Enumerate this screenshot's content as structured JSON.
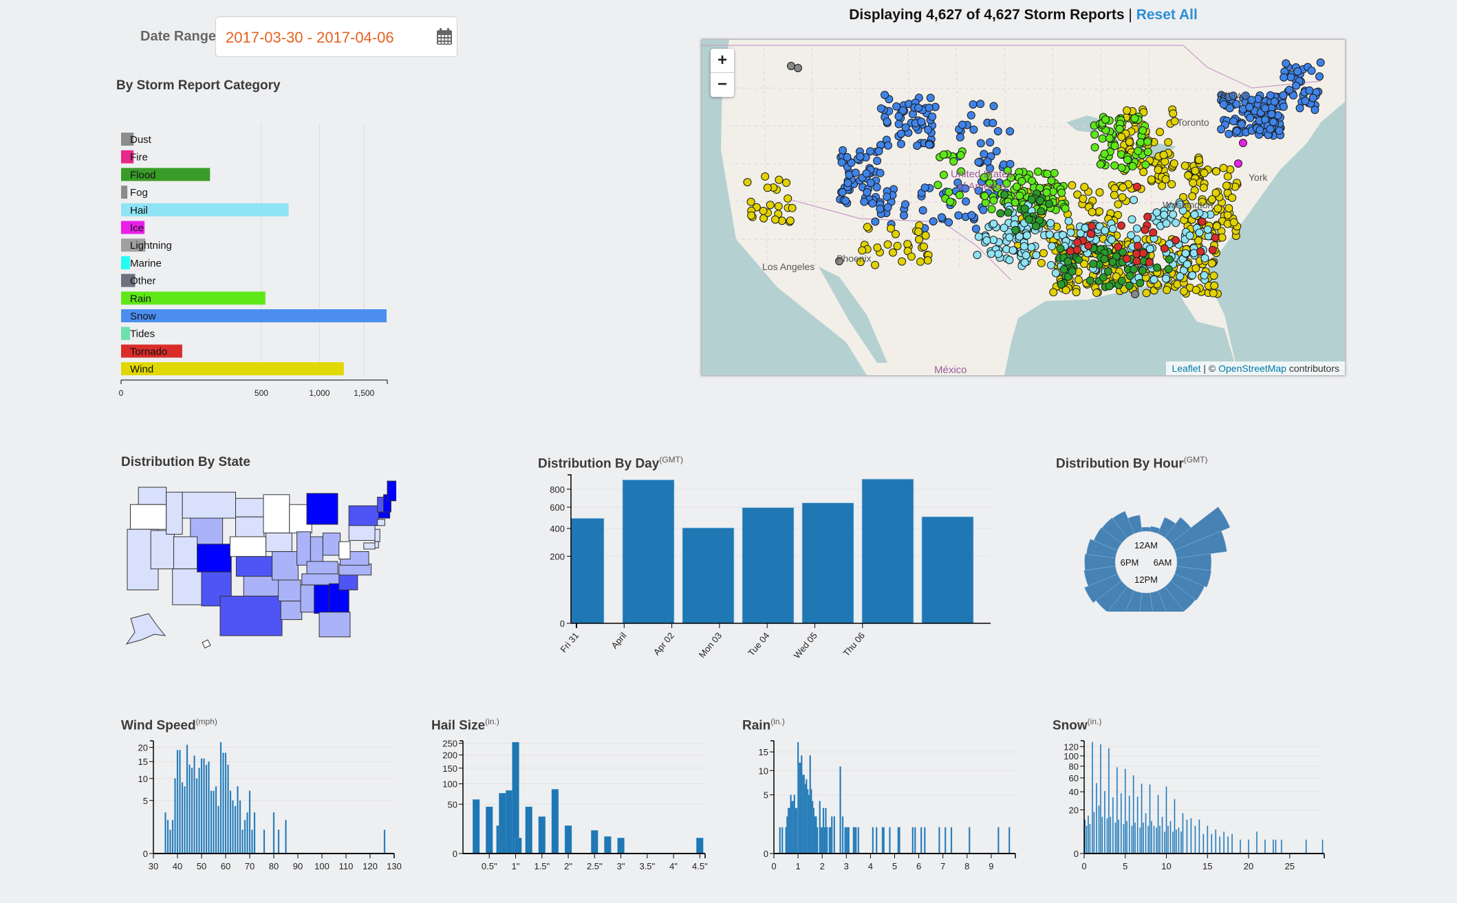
{
  "date_range": {
    "label": "Date Range:",
    "value": "2017-03-30 - 2017-04-06",
    "icon": "calendar-icon"
  },
  "header": {
    "displaying_text": "Displaying 4,627 of 4,627 Storm Reports",
    "separator": "|",
    "reset_label": "Reset All"
  },
  "map": {
    "zoom_in": "+",
    "zoom_out": "−",
    "attribution": {
      "leaflet": "Leaflet",
      "sep": " | © ",
      "osm": "OpenStreetMap",
      "suffix": " contributors"
    },
    "labels": {
      "ottawa": "Ottawa",
      "toronto": "Toronto",
      "usa_line1": "United States",
      "usa_line2": "of America",
      "los_angeles": "Los Angeles",
      "phoenix": "Phoenix",
      "new_york": "York",
      "washington": "Washington",
      "mexico": "México"
    },
    "colors": {
      "water": "#b5d0d0",
      "land": "#f2efe9"
    }
  },
  "titles": {
    "category": "By Storm Report Category",
    "state": "Distribution By State",
    "day": "Distribution By Day",
    "day_sup": "(GMT)",
    "hour": "Distribution By Hour",
    "hour_sup": "(GMT)",
    "wind": "Wind Speed",
    "wind_sup": "(mph)",
    "hail": "Hail Size",
    "hail_sup": "(in.)",
    "rain": "Rain",
    "rain_sup": "(in.)",
    "snow": "Snow",
    "snow_sup": "(in.)"
  },
  "chart_data": [
    {
      "id": "category",
      "type": "bar",
      "orientation": "horizontal",
      "title": "By Storm Report Category",
      "scale": "sqrt",
      "categories": [
        "Dust",
        "Fire",
        "Flood",
        "Fog",
        "Hail",
        "Ice",
        "Lightning",
        "Marine",
        "Other",
        "Rain",
        "Snow",
        "Tides",
        "Tornado",
        "Wind"
      ],
      "values": [
        4,
        4,
        201,
        1,
        713,
        14,
        15,
        2,
        5,
        529,
        1791,
        2,
        95,
        1260
      ],
      "colors": [
        "#8c8c8c",
        "#e7298a",
        "#3a9c28",
        "#8c8c8c",
        "#8ee3f5",
        "#e920e9",
        "#a0a0a0",
        "#21fdf0",
        "#6f7180",
        "#5fe818",
        "#4b8ef0",
        "#6ce0ab",
        "#d92d2a",
        "#e0d800"
      ],
      "xticks": [
        0,
        500,
        1000,
        1500
      ],
      "xtick_labels": [
        "0",
        "500",
        "1,000",
        "1,500"
      ],
      "xlim": [
        0,
        1791
      ],
      "grid": true
    },
    {
      "id": "day",
      "type": "bar",
      "title": "Distribution By Day (GMT)",
      "scale": "sqrt",
      "categories": [
        "Fri 31",
        "April",
        "Apr 02",
        "Mon 03",
        "Tue 04",
        "Wed 05",
        "Thu 06"
      ],
      "values": [
        490,
        915,
        405,
        595,
        645,
        925,
        505
      ],
      "color": "#1f77b4",
      "yticks": [
        0,
        200,
        400,
        600,
        800
      ],
      "ylim": [
        0,
        935
      ],
      "grid": true
    },
    {
      "id": "hour",
      "type": "bar",
      "subtype": "radial",
      "title": "Distribution By Hour (GMT)",
      "labels": [
        "12AM",
        "6AM",
        "12PM",
        "6PM"
      ],
      "hours": [
        0,
        1,
        2,
        3,
        4,
        5,
        6,
        7,
        8,
        9,
        10,
        11,
        12,
        13,
        14,
        15,
        16,
        17,
        18,
        19,
        20,
        21,
        22,
        23
      ],
      "values": [
        15,
        25,
        45,
        95,
        520,
        370,
        170,
        175,
        150,
        140,
        160,
        175,
        165,
        130,
        140,
        150,
        185,
        145,
        135,
        125,
        95,
        90,
        85,
        40
      ],
      "color": "#4682b4"
    },
    {
      "id": "state",
      "type": "heatmap",
      "subtype": "choropleth",
      "title": "Distribution By State",
      "high_states": [
        "CO",
        "MI",
        "ME",
        "NH",
        "MA",
        "AL",
        "GA"
      ],
      "mid_states": [
        "TX",
        "NM",
        "KS",
        "SC",
        "NY",
        "VT"
      ],
      "low_mid_states": [
        "WY",
        "OK",
        "MO",
        "IL",
        "OH",
        "KY",
        "VA",
        "NC",
        "TN",
        "MS",
        "LA",
        "FL",
        "IN",
        "AR"
      ],
      "low_states": [
        "CA",
        "NV",
        "AZ",
        "ID",
        "MT",
        "UT",
        "SD",
        "IA",
        "ND",
        "WA",
        "AK",
        "PA",
        "NJ",
        "CT",
        "MD",
        "DE"
      ],
      "zero_states": [
        "OR",
        "NE",
        "MN",
        "WI",
        "WV",
        "HI"
      ]
    },
    {
      "id": "wind",
      "type": "bar",
      "subtype": "histogram",
      "title": "Wind Speed (mph)",
      "scale": "sqrt",
      "x": [
        35,
        36,
        37,
        38,
        39,
        40,
        41,
        42,
        43,
        44,
        45,
        46,
        47,
        48,
        49,
        50,
        51,
        52,
        53,
        54,
        55,
        56,
        57,
        58,
        59,
        60,
        61,
        62,
        63,
        64,
        65,
        66,
        67,
        68,
        69,
        70,
        71,
        72,
        76,
        80,
        82,
        85,
        126
      ],
      "values": [
        3,
        2,
        1,
        2,
        10,
        19,
        19,
        9,
        8,
        21,
        14,
        13,
        17,
        10,
        13,
        16,
        16,
        14,
        15,
        7,
        7,
        8,
        4,
        22,
        18,
        18,
        14,
        7,
        5,
        4,
        8,
        5,
        1,
        2,
        3,
        7,
        1,
        3,
        1,
        3,
        1,
        2,
        1
      ],
      "xticks": [
        30,
        40,
        50,
        60,
        70,
        80,
        90,
        100,
        110,
        120,
        130
      ],
      "yticks": [
        0,
        5,
        10,
        15,
        20
      ],
      "xlim": [
        30,
        130
      ],
      "ylim": [
        0,
        22
      ]
    },
    {
      "id": "hail",
      "type": "bar",
      "subtype": "histogram",
      "title": "Hail Size (in.)",
      "scale": "sqrt",
      "x": [
        0.25,
        0.5,
        0.7,
        0.75,
        0.8,
        0.88,
        1.0,
        1.05,
        1.25,
        1.5,
        1.75,
        2.0,
        2.5,
        2.75,
        3.0,
        4.5
      ],
      "values": [
        60,
        45,
        16,
        75,
        3,
        82,
        255,
        5,
        45,
        28,
        85,
        16,
        11,
        6,
        5,
        5
      ],
      "xticks": [
        0.5,
        1,
        1.5,
        2,
        2.5,
        3,
        3.5,
        4,
        4.5
      ],
      "xtick_labels": [
        "0.5\"",
        "1\"",
        "1.5\"",
        "2\"",
        "2.5\"",
        "3\"",
        "3.5\"",
        "4\"",
        "4.5\""
      ],
      "yticks": [
        0,
        50,
        100,
        150,
        200,
        250
      ],
      "xlim": [
        0,
        4.6
      ],
      "ylim": [
        0,
        255
      ]
    },
    {
      "id": "rain",
      "type": "bar",
      "subtype": "histogram",
      "title": "Rain (in.)",
      "scale": "sqrt",
      "x": [
        0.25,
        0.35,
        0.5,
        0.55,
        0.6,
        0.65,
        0.7,
        0.75,
        0.8,
        0.85,
        0.9,
        0.95,
        1.0,
        1.02,
        1.05,
        1.1,
        1.15,
        1.2,
        1.25,
        1.3,
        1.35,
        1.4,
        1.45,
        1.5,
        1.55,
        1.6,
        1.65,
        1.7,
        1.75,
        1.8,
        1.9,
        1.95,
        2.0,
        2.05,
        2.1,
        2.15,
        2.2,
        2.3,
        2.35,
        2.4,
        2.5,
        2.75,
        2.85,
        2.95,
        3.0,
        3.05,
        3.1,
        3.3,
        3.35,
        3.4,
        3.5,
        4.1,
        4.25,
        4.5,
        4.55,
        4.8,
        5.15,
        5.2,
        5.75,
        5.85,
        6.1,
        6.25,
        6.85,
        7.1,
        7.35,
        8.1,
        9.3,
        9.75
      ],
      "values": [
        1,
        1,
        1,
        2,
        3,
        3,
        5,
        4,
        4,
        5,
        3,
        3,
        18,
        11,
        12,
        12,
        14,
        9,
        9,
        7,
        8,
        6,
        5,
        14,
        6,
        4,
        3,
        2,
        2,
        1,
        4,
        1,
        1,
        3,
        1,
        3,
        1,
        1,
        1,
        2,
        2,
        11,
        2,
        1,
        1,
        1,
        1,
        1,
        1,
        1,
        1,
        1,
        1,
        1,
        1,
        1,
        1,
        1,
        1,
        1,
        1,
        1,
        1,
        1,
        1,
        1,
        1,
        1
      ],
      "xticks": [
        0,
        1,
        2,
        3,
        4,
        5,
        6,
        7,
        8,
        9
      ],
      "yticks": [
        0,
        5,
        10,
        15
      ],
      "xlim": [
        0,
        10
      ],
      "ylim": [
        0,
        18
      ]
    },
    {
      "id": "snow",
      "type": "bar",
      "subtype": "histogram",
      "title": "Snow (in.)",
      "scale": "sqrt",
      "x": [
        0.1,
        0.3,
        0.5,
        0.7,
        1.0,
        1.2,
        1.5,
        1.8,
        2.0,
        2.2,
        2.5,
        2.8,
        3.0,
        3.2,
        3.5,
        3.8,
        4.0,
        4.2,
        4.5,
        4.8,
        5.0,
        5.2,
        5.5,
        5.8,
        6.0,
        6.2,
        6.5,
        6.8,
        7.0,
        7.2,
        7.5,
        7.8,
        8.0,
        8.2,
        8.5,
        8.8,
        9.0,
        9.2,
        9.5,
        9.8,
        10.0,
        10.2,
        10.5,
        10.8,
        11.0,
        11.2,
        11.5,
        11.8,
        12.0,
        12.5,
        13.0,
        13.5,
        14.0,
        14.5,
        15.0,
        15.5,
        16.0,
        16.5,
        17.0,
        17.5,
        18.0,
        19.0,
        20.0,
        21.0,
        22.0,
        23.0,
        23.3,
        24.0,
        27.0,
        29.0
      ],
      "values": [
        12,
        8,
        15,
        9,
        130,
        18,
        52,
        24,
        125,
        14,
        41,
        13,
        116,
        14,
        33,
        10,
        78,
        12,
        38,
        9,
        75,
        11,
        35,
        8,
        64,
        10,
        34,
        7,
        51,
        10,
        17,
        8,
        50,
        11,
        8,
        7,
        36,
        8,
        14,
        5,
        47,
        8,
        11,
        5,
        31,
        6,
        7,
        5,
        17,
        12,
        13,
        8,
        12,
        4,
        8,
        4,
        6,
        3,
        5,
        3,
        4,
        2,
        2,
        5,
        2,
        2,
        2,
        2,
        2,
        2
      ],
      "xticks": [
        0,
        5,
        10,
        15,
        20,
        25
      ],
      "yticks": [
        0,
        20,
        40,
        60,
        80,
        100,
        120
      ],
      "xlim": [
        0,
        29.2
      ],
      "ylim": [
        0,
        130
      ]
    }
  ]
}
